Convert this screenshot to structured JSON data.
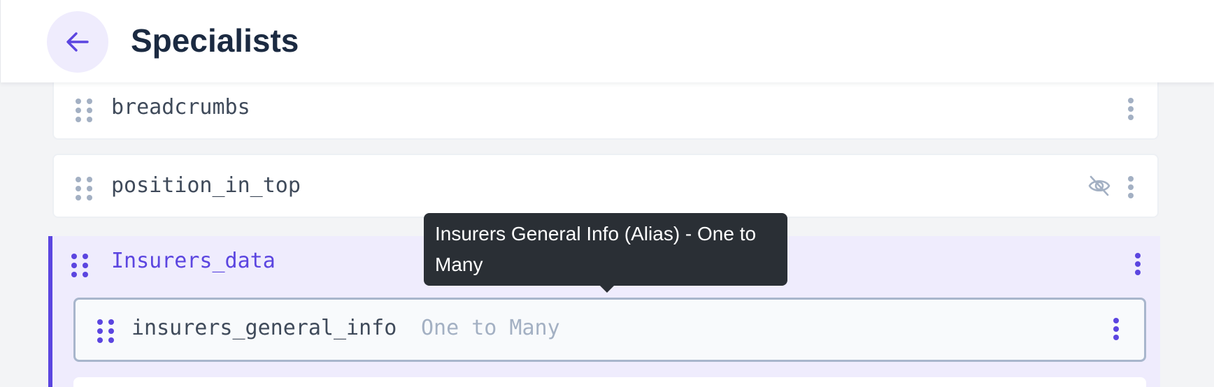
{
  "header": {
    "back_icon": "arrow-left-icon",
    "title": "Specialists"
  },
  "fields": [
    {
      "name": "breadcrumbs",
      "hidden": false
    },
    {
      "name": "position_in_top",
      "hidden": true,
      "hidden_icon": "eye-off-icon"
    }
  ],
  "group": {
    "name": "Insurers_data",
    "children": [
      {
        "name": "insurers_general_info",
        "relation": "One to Many"
      }
    ]
  },
  "tooltip": {
    "text": "Insurers General Info (Alias) - One to Many"
  },
  "colors": {
    "accent": "#5b45e0",
    "group_bg": "#efecfd",
    "title": "#1b2a41",
    "muted_icon": "#a3b0c3",
    "tooltip_bg": "#2a2f35"
  }
}
